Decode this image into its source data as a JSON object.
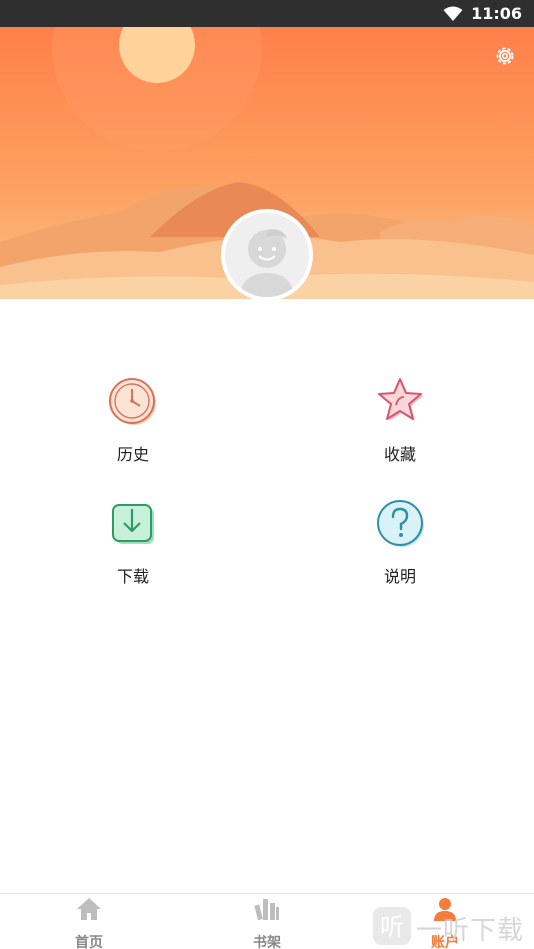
{
  "status_bar": {
    "time": "11:06",
    "wifi_icon": "wifi-icon"
  },
  "header": {
    "settings_icon": "gear-icon"
  },
  "menu": {
    "items": [
      {
        "label": "历史",
        "icon": "clock-icon"
      },
      {
        "label": "收藏",
        "icon": "star-icon"
      },
      {
        "label": "下载",
        "icon": "download-icon"
      },
      {
        "label": "说明",
        "icon": "question-icon"
      }
    ]
  },
  "bottom_nav": {
    "items": [
      {
        "label": "首页",
        "icon": "home-icon",
        "active": false
      },
      {
        "label": "书架",
        "icon": "bookshelf-icon",
        "active": false
      },
      {
        "label": "账户",
        "icon": "person-icon",
        "active": true
      }
    ]
  },
  "watermark": {
    "text": "一听下载",
    "logo": "听"
  },
  "colors": {
    "accent": "#f47c3c",
    "banner_top": "#ff7f4a",
    "banner_bottom": "#fbc08a"
  }
}
